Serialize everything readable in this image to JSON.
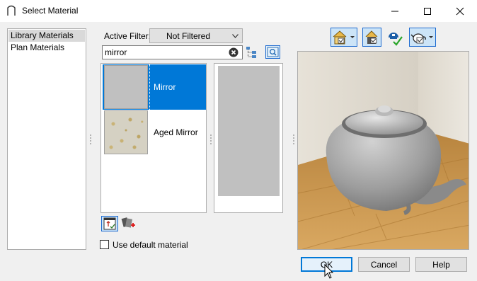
{
  "window": {
    "title": "Select Material"
  },
  "categories": [
    {
      "label": "Library Materials",
      "selected": true
    },
    {
      "label": "Plan Materials",
      "selected": false
    }
  ],
  "filter": {
    "label": "Active Filter:",
    "value": "Not Filtered"
  },
  "search": {
    "value": "mirror"
  },
  "results": [
    {
      "label": "Mirror",
      "selected": true
    },
    {
      "label": "Aged Mirror",
      "selected": false
    }
  ],
  "options": {
    "use_default_label": "Use default material",
    "use_default_checked": false
  },
  "buttons": {
    "ok": "OK",
    "cancel": "Cancel",
    "help": "Help"
  },
  "colors": {
    "accent": "#0078d7",
    "selected_row": "#0078d7",
    "mirror_swatch": "#c0c0c0"
  }
}
